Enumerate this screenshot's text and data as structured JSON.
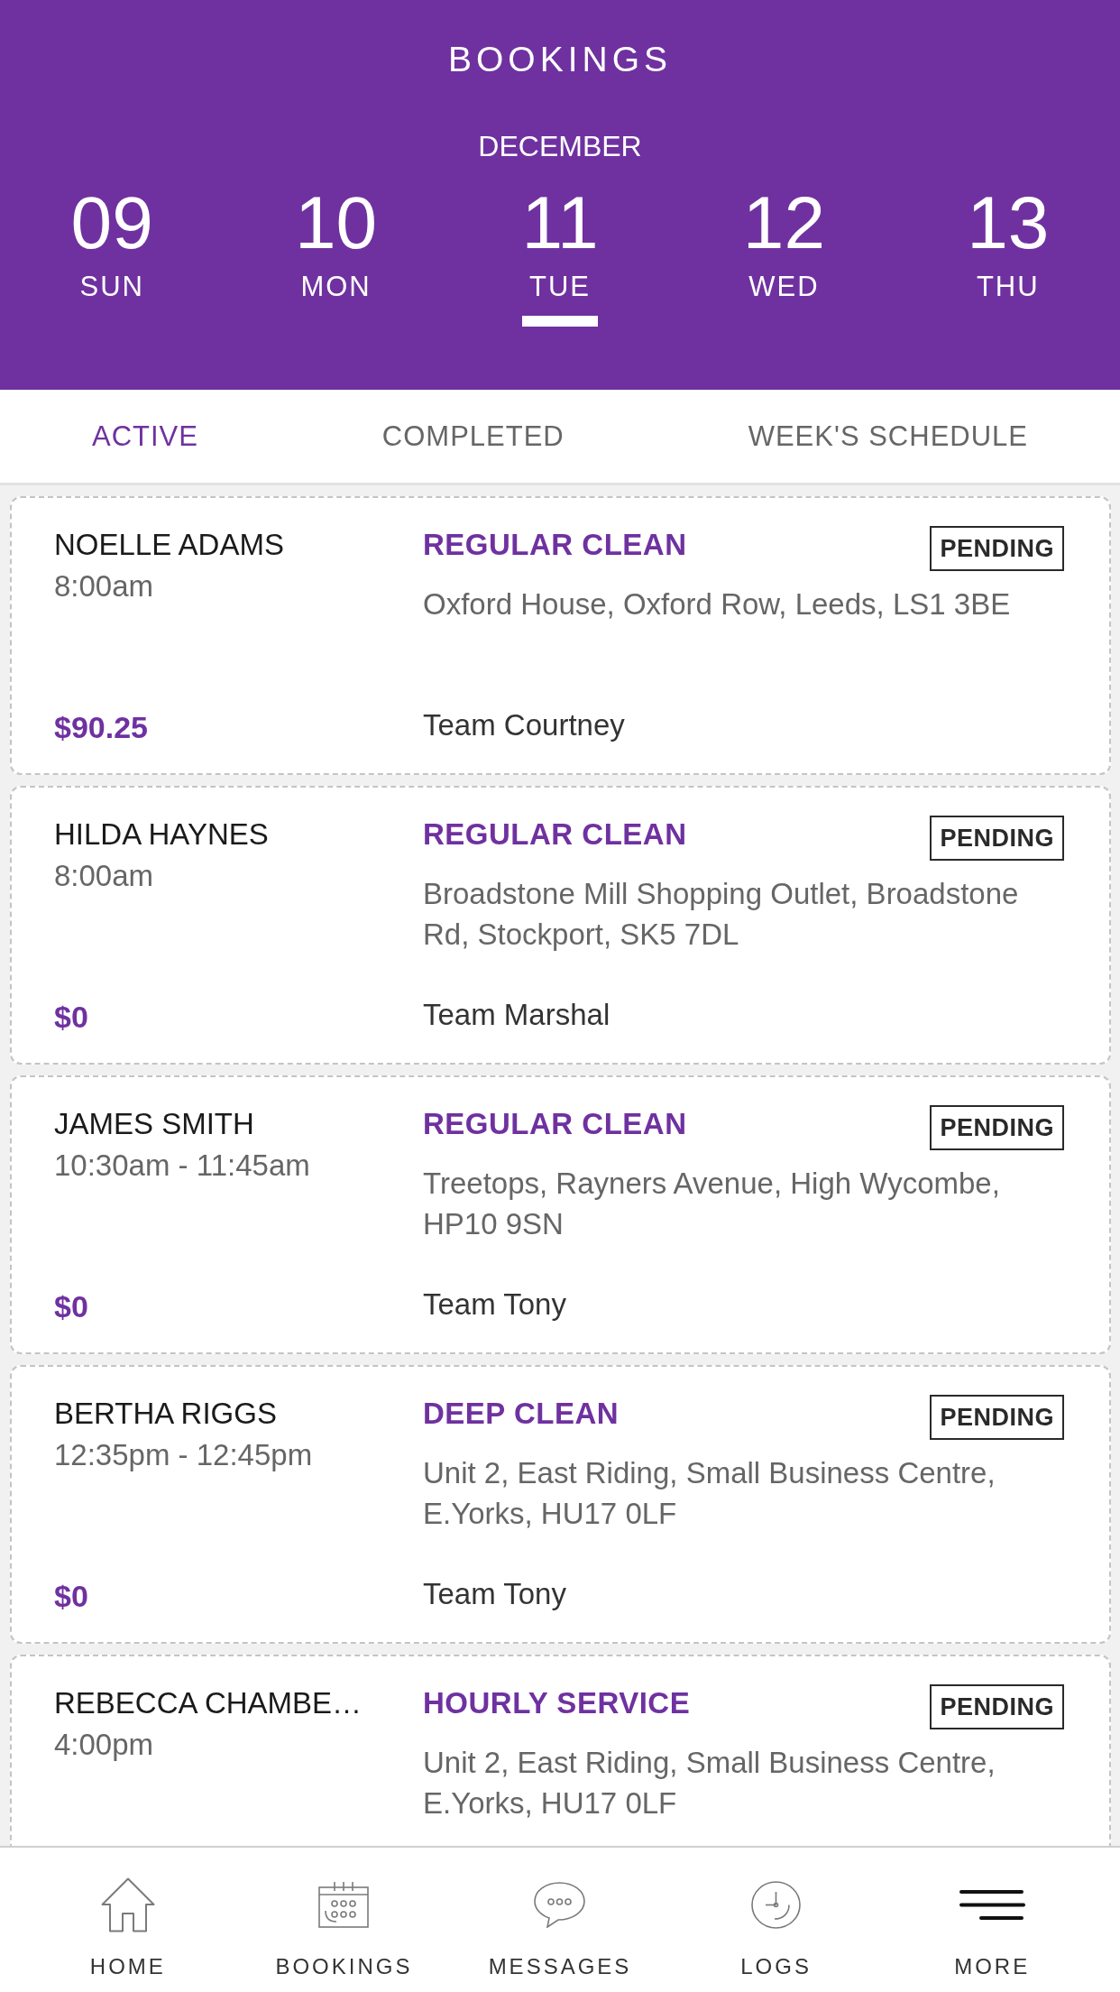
{
  "header": {
    "title": "BOOKINGS",
    "month": "DECEMBER",
    "days": [
      {
        "date": "09",
        "weekday": "SUN",
        "selected": false
      },
      {
        "date": "10",
        "weekday": "MON",
        "selected": false
      },
      {
        "date": "11",
        "weekday": "TUE",
        "selected": true
      },
      {
        "date": "12",
        "weekday": "WED",
        "selected": false
      },
      {
        "date": "13",
        "weekday": "THU",
        "selected": false
      }
    ]
  },
  "tabs": [
    {
      "label": "ACTIVE",
      "selected": true
    },
    {
      "label": "COMPLETED",
      "selected": false
    },
    {
      "label": "WEEK'S SCHEDULE",
      "selected": false
    }
  ],
  "bookings": [
    {
      "customer": "NOELLE ADAMS",
      "time": "8:00am",
      "price": "$90.25",
      "service": "REGULAR CLEAN",
      "status": "PENDING",
      "address": "Oxford House, Oxford Row, Leeds, LS1 3BE",
      "team": "Team Courtney"
    },
    {
      "customer": "HILDA HAYNES",
      "time": "8:00am",
      "price": "$0",
      "service": "REGULAR CLEAN",
      "status": "PENDING",
      "address": "Broadstone Mill Shopping Outlet, Broadstone Rd, Stockport, SK5 7DL",
      "team": "Team Marshal"
    },
    {
      "customer": "JAMES SMITH",
      "time": "10:30am - 11:45am",
      "price": "$0",
      "service": "REGULAR CLEAN",
      "status": "PENDING",
      "address": "Treetops, Rayners Avenue, High Wycombe, HP10 9SN",
      "team": "Team Tony"
    },
    {
      "customer": "BERTHA RIGGS",
      "time": "12:35pm - 12:45pm",
      "price": "$0",
      "service": "DEEP CLEAN",
      "status": "PENDING",
      "address": "Unit 2, East Riding, Small Business Centre, E.Yorks, HU17 0LF",
      "team": "Team Tony"
    },
    {
      "customer": "REBECCA CHAMBE…",
      "time": "4:00pm",
      "service": "HOURLY SERVICE",
      "status": "PENDING",
      "address": "Unit 2, East Riding, Small Business Centre, E.Yorks, HU17 0LF"
    }
  ],
  "bottom_nav": [
    {
      "label": "HOME",
      "kind": "home"
    },
    {
      "label": "BOOKINGS",
      "kind": "calendar"
    },
    {
      "label": "MESSAGES",
      "kind": "chat"
    },
    {
      "label": "LOGS",
      "kind": "clock"
    },
    {
      "label": "MORE",
      "kind": "menu"
    }
  ]
}
